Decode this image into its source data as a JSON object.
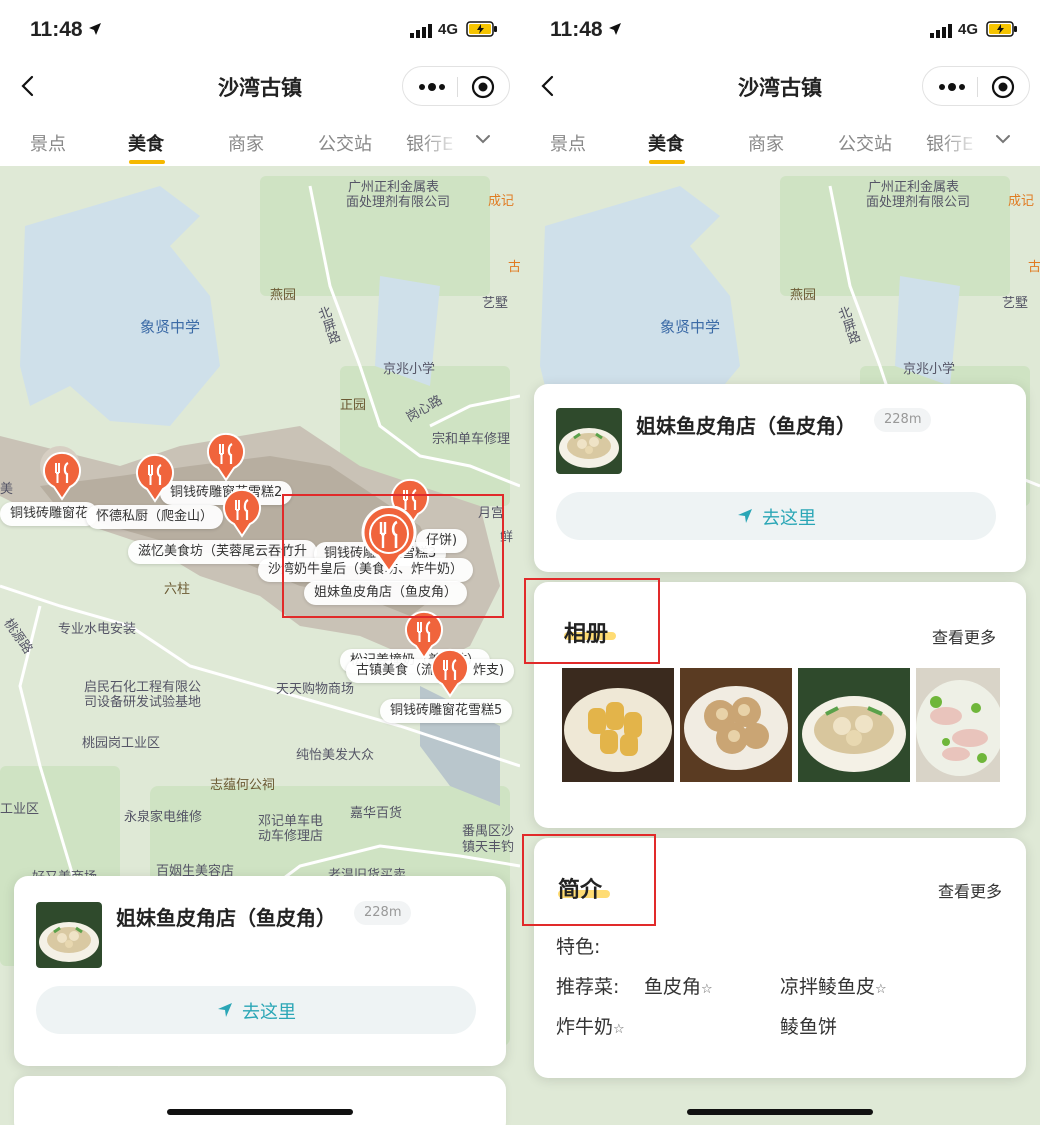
{
  "status_bar": {
    "time": "11:48",
    "network": "4G"
  },
  "nav": {
    "title": "沙湾古镇"
  },
  "tabs": [
    "景点",
    "美食",
    "商家",
    "公交站",
    "银行Ε"
  ],
  "active_tab_index": 1,
  "map": {
    "labels": {
      "zhengli": "广州正利金属表",
      "zhengli2": "面处理剂有限公司",
      "chengji": "成记",
      "gu": "古",
      "yanyuan": "燕园",
      "yixian": "象贤中学",
      "beiping": "北屏路",
      "yiwan": "艺墅",
      "jingzhao": "京兆小学",
      "zhengyuan": "正园",
      "ganxin": "岗心路",
      "zonghe": "宗和单车修理",
      "mei": "美",
      "yuegong": "月宫",
      "xian": "鲜",
      "liuzhuan": "六柱",
      "tao": "桃源路",
      "shuidian": "专业水电安装",
      "qiyuan": "启民石化工程有限公",
      "qiyuan2": "司设备研发试验基地",
      "tianti": "天天购物商场",
      "taoyuan": "桃园岗工业区",
      "chunyi": "纯怡美发大众",
      "zhiyun": "志蕴何公祠",
      "gongye": "工业区",
      "yongquan": "永泉家电维修",
      "dengji": "邓记单车电",
      "dengji2": "动车修理店",
      "jiahua": "嘉华百货",
      "fanyu": "番禺区沙",
      "fanyu2": "镇天丰钓",
      "baiyi": "百姻生美容店",
      "laowen": "老温旧货买卖",
      "haoyi": "好又美商场"
    },
    "chips": {
      "tongqian2": "铜钱砖雕窗花雪糕2",
      "tongqian_left": "铜钱砖雕窗花",
      "huaide": "怀德私厨（爬金山）",
      "ziyi": "滋忆美食坊（芙蓉尾云吞竹升",
      "tongqian3": "铜钱砖雕窗花雪糕3",
      "zaizai": "仔饼)",
      "nainiu": "沙湾奶牛皇后（美食坊、炸牛奶）",
      "jiemei": "姐妹鱼皮角店（鱼皮角）",
      "songji": "松记姜撞奶（美食坊）",
      "guzhen": "古镇美食（流星糕、炸支)",
      "tongqian5": "铜钱砖雕窗花雪糕5"
    }
  },
  "shop": {
    "name": "姐妹鱼皮角店（鱼皮角）",
    "distance": "228m",
    "go_label": "去这里"
  },
  "album": {
    "title": "相册",
    "more": "查看更多",
    "photos": [
      "pancake",
      "fried-fritter",
      "fish-soup",
      "fish-skin-salad"
    ]
  },
  "intro": {
    "title": "简介",
    "more": "查看更多",
    "feature_label": "特色:",
    "recommend_label": "推荐菜:",
    "dishes": [
      "鱼皮角",
      "凉拌鲮鱼皮",
      "炸牛奶",
      "鲮鱼饼"
    ],
    "star": "☆"
  },
  "colors": {
    "accent_yellow": "#f5b800",
    "pin_orange": "#f0643c",
    "go_teal": "#2aa6b6",
    "highlight_red": "#e12a2a"
  }
}
